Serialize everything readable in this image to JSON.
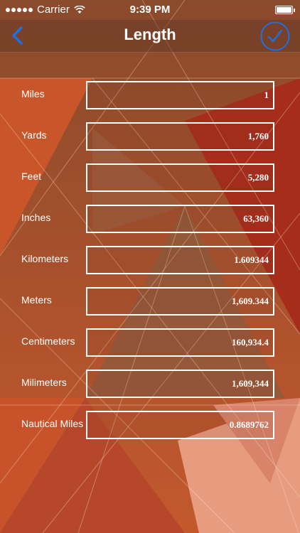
{
  "status_bar": {
    "carrier": "Carrier",
    "time": "9:39 PM",
    "icons": [
      "signal-icon",
      "wifi-icon",
      "battery-icon"
    ]
  },
  "nav": {
    "title": "Length",
    "back_icon": "chevron-left-icon",
    "done_icon": "checkmark-icon",
    "accent_color": "#1f6fe0"
  },
  "units": [
    {
      "label": "Miles",
      "value": "1"
    },
    {
      "label": "Yards",
      "value": "1,760"
    },
    {
      "label": "Feet",
      "value": "5,280"
    },
    {
      "label": "Inches",
      "value": "63,360"
    },
    {
      "label": "Kilometers",
      "value": "1.609344"
    },
    {
      "label": "Meters",
      "value": "1,609.344"
    },
    {
      "label": "Centimeters",
      "value": "160,934.4"
    },
    {
      "label": "Milimeters",
      "value": "1,609,344"
    },
    {
      "label": "Nautical Miles",
      "value": "0.8689762"
    }
  ]
}
